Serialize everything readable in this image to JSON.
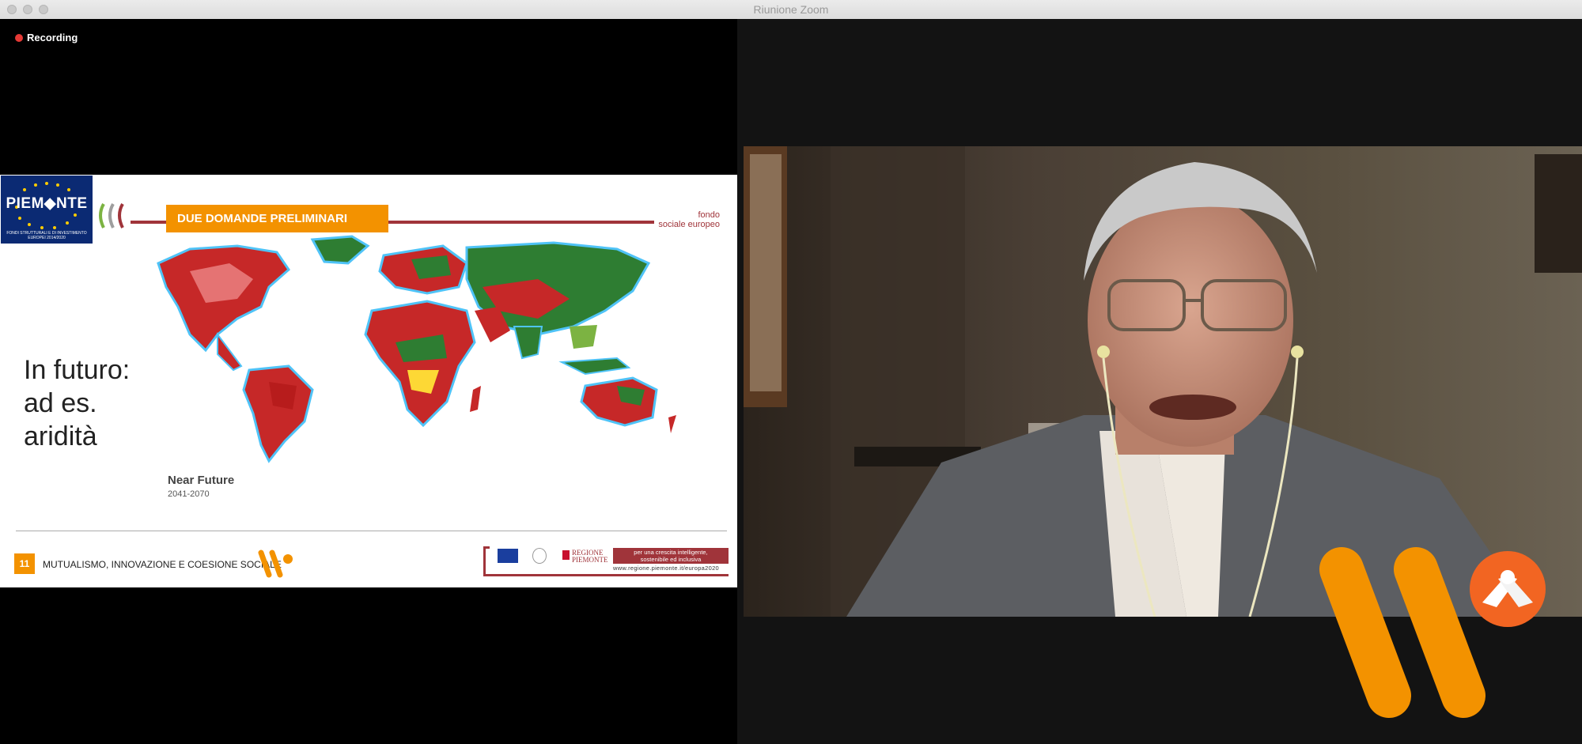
{
  "window": {
    "title": "Riunione Zoom"
  },
  "recording": {
    "label": "Recording"
  },
  "slide": {
    "logo_text": "PIEM◆NTE",
    "logo_subtext": "FONDI STRUTTURALI E DI INVESTIMENTO EUROPEI 2014/2020",
    "header": "DUE DOMANDE PRELIMINARI",
    "fondo_line1": "fondo",
    "fondo_line2": "sociale europeo",
    "body_lines": [
      "In futuro:",
      "ad es.",
      "aridità"
    ],
    "map_caption": "Near Future",
    "map_years": "2041-2070",
    "page_number": "11",
    "footer_title": "MUTUALISMO, INNOVAZIONE E COESIONE SOCIALE",
    "regione_line1": "REGIONE",
    "regione_line2": "PIEMONTE",
    "growth_line1": "per una crescita intelligente,",
    "growth_line2": "sostenibile ed inclusiva",
    "url": "www.regione.piemonte.it/europa2020"
  },
  "colors": {
    "accent_orange": "#f39200",
    "slide_red": "#a0343a",
    "recording_dot": "#e53935"
  },
  "icons": {
    "recording": "recording-dot-icon",
    "brand": "w-brand-logo-icon",
    "handshake": "handshake-icon"
  }
}
